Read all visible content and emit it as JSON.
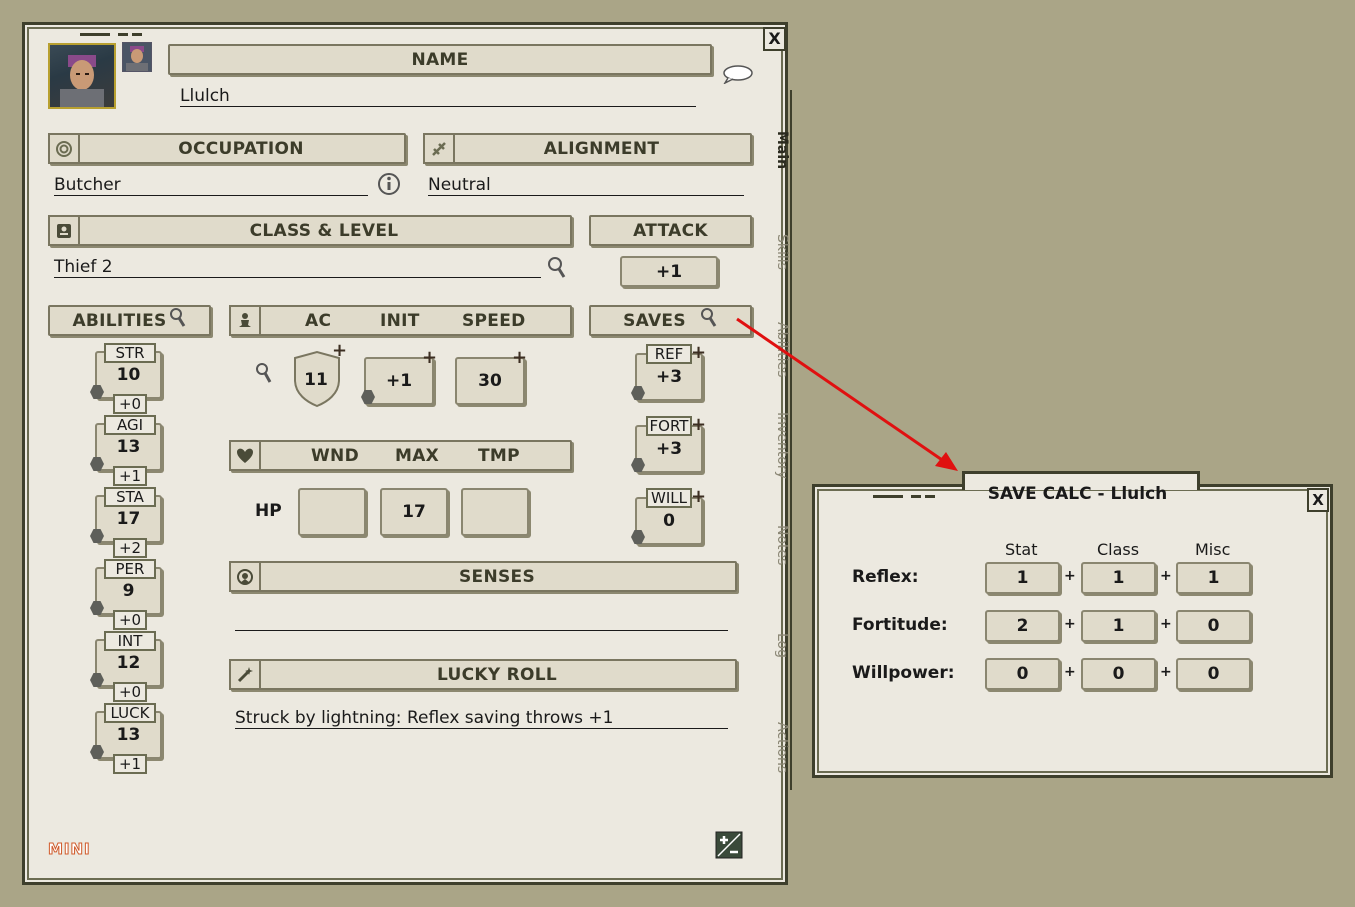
{
  "sheet": {
    "name_header": "NAME",
    "name": "Llulch",
    "occupation_header": "OCCUPATION",
    "occupation": "Butcher",
    "alignment_header": "ALIGNMENT",
    "alignment": "Neutral",
    "class_header": "CLASS & LEVEL",
    "class_level": "Thief 2",
    "attack_header": "ATTACK",
    "attack": "+1",
    "abilities_header": "ABILITIES",
    "abilities": [
      {
        "name": "STR",
        "value": "10",
        "mod": "+0"
      },
      {
        "name": "AGI",
        "value": "13",
        "mod": "+1"
      },
      {
        "name": "STA",
        "value": "17",
        "mod": "+2"
      },
      {
        "name": "PER",
        "value": "9",
        "mod": "+0"
      },
      {
        "name": "INT",
        "value": "12",
        "mod": "+0"
      },
      {
        "name": "LUCK",
        "value": "13",
        "mod": "+1"
      }
    ],
    "combat": {
      "ac_label": "AC",
      "init_label": "INIT",
      "speed_label": "SPEED",
      "ac": "11",
      "init": "+1",
      "speed": "30"
    },
    "hp": {
      "wnd_label": "WND",
      "max_label": "MAX",
      "tmp_label": "TMP",
      "hp_label": "HP",
      "wnd": "",
      "max": "17",
      "tmp": ""
    },
    "saves_header": "SAVES",
    "saves": [
      {
        "name": "REF",
        "value": "+3"
      },
      {
        "name": "FORT",
        "value": "+3"
      },
      {
        "name": "WILL",
        "value": "0"
      }
    ],
    "senses_header": "SENSES",
    "senses": "",
    "lucky_header": "LUCKY ROLL",
    "lucky_roll": "Struck by lightning: Reflex saving throws +1",
    "mini_label": "MINI",
    "close_label": "X",
    "tabs": [
      "Main",
      "Skills",
      "Abilities",
      "Inventory",
      "Notes",
      "Log",
      "Actions"
    ]
  },
  "save_calc": {
    "title": "SAVE CALC - Llulch",
    "close_label": "X",
    "columns": [
      "Stat",
      "Class",
      "Misc"
    ],
    "rows": [
      {
        "label": "Reflex:",
        "stat": "1",
        "class": "1",
        "misc": "1"
      },
      {
        "label": "Fortitude:",
        "stat": "2",
        "class": "1",
        "misc": "0"
      },
      {
        "label": "Willpower:",
        "stat": "0",
        "class": "0",
        "misc": "0"
      }
    ],
    "op": "+"
  },
  "colors": {
    "background": "#aaa587",
    "panel": "#ece9e0",
    "field": "#e0dbcb",
    "arrow": "#e01010"
  },
  "icons": [
    "portrait",
    "token-portrait",
    "chat-bubble-icon",
    "fingerprint-icon",
    "compass-icon",
    "info-icon",
    "class-card-icon",
    "magnifier-icon",
    "meditation-icon",
    "heart-shield-icon",
    "senses-icon",
    "wand-icon",
    "edit-icon"
  ]
}
